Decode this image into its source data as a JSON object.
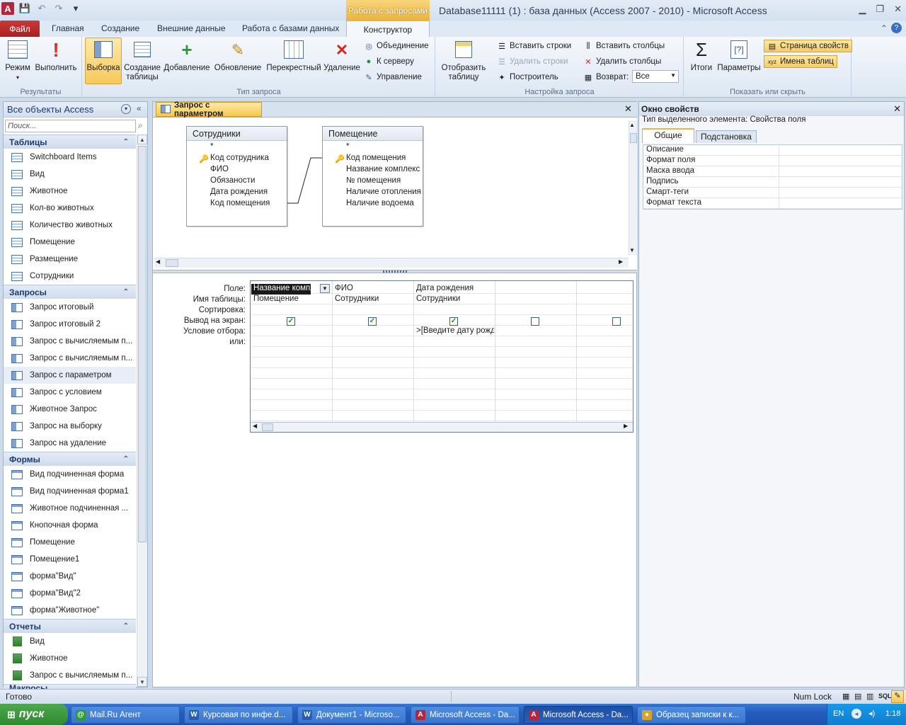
{
  "window": {
    "title": "Database11111 (1) : база данных (Access 2007 - 2010)  -  Microsoft Access",
    "context_tab_title": "Работа с запросами",
    "app_icon_letter": "A"
  },
  "tabs": {
    "file": "Файл",
    "home": "Главная",
    "create": "Создание",
    "external": "Внешние данные",
    "dbtools": "Работа с базами данных",
    "constructor": "Конструктор"
  },
  "ribbon": {
    "results": {
      "label": "Результаты",
      "mode": "Режим",
      "run": "Выполнить"
    },
    "query_type": {
      "label": "Тип запроса",
      "select": "Выборка",
      "make_table": "Создание таблицы",
      "append": "Добавление",
      "update": "Обновление",
      "crosstab": "Перекрестный",
      "delete": "Удаление",
      "union": "Объединение",
      "to_server": "К серверу",
      "management": "Управление"
    },
    "setup": {
      "label": "Настройка запроса",
      "show_table": "Отобразить таблицу",
      "insert_rows": "Вставить строки",
      "delete_rows": "Удалить строки",
      "builder": "Построитель",
      "insert_cols": "Вставить столбцы",
      "delete_cols": "Удалить столбцы",
      "return_label": "Возврат:",
      "return_value": "Все"
    },
    "show_hide": {
      "label": "Показать или скрыть",
      "totals": "Итоги",
      "parameters": "Параметры",
      "property_sheet": "Страница свойств",
      "table_names": "Имена таблиц"
    }
  },
  "nav": {
    "title": "Все объекты Access",
    "search_placeholder": "Поиск...",
    "sections": [
      {
        "title": "Таблицы",
        "type": "table",
        "items": [
          "Switchboard Items",
          "Вид",
          "Животное",
          "Кол-во животных",
          "Количество животных",
          "Помещение",
          "Размещение",
          "Сотрудники"
        ]
      },
      {
        "title": "Запросы",
        "type": "query",
        "items": [
          "Запрос итоговый",
          "Запрос итоговый 2",
          "Запрос с вычисляемым п...",
          "Запрос с вычисляемым п...",
          "Запрос с параметром",
          "Запрос с условием",
          "Животное Запрос",
          "Запрос на выборку",
          "Запрос на удаление"
        ]
      },
      {
        "title": "Формы",
        "type": "form",
        "items": [
          "Вид подчиненная форма",
          "Вид подчиненная форма1",
          "Животное подчиненная ...",
          "Кнопочная форма",
          "Помещение",
          "Помещение1",
          "форма\"Вид\"",
          "форма\"Вид\"2",
          "форма\"Животное\""
        ]
      },
      {
        "title": "Отчеты",
        "type": "report",
        "items": [
          "Вид",
          "Животное",
          "Запрос с вычисляемым п..."
        ]
      }
    ],
    "cut_section": "Макросы",
    "selected_item": "Запрос с параметром"
  },
  "doc": {
    "tab_title": "Запрос с параметром",
    "tables": [
      {
        "name": "Сотрудники",
        "fields": [
          "*",
          "Код сотрудника",
          "ФИО",
          "Обязаности",
          "Дата рождения",
          "Код помещения"
        ],
        "key_field": "Код сотрудника"
      },
      {
        "name": "Помещение",
        "fields": [
          "*",
          "Код помещения",
          "Название комплекс",
          "№ помещения",
          "Наличие отопления",
          "Наличие водоема"
        ],
        "key_field": "Код помещения"
      }
    ],
    "grid": {
      "row_labels": [
        "Поле:",
        "Имя таблицы:",
        "Сортировка:",
        "Вывод на экран:",
        "Условие отбора:",
        "или:"
      ],
      "columns": [
        {
          "field": "Название компле",
          "table": "Помещение",
          "show": true,
          "criteria": ""
        },
        {
          "field": "ФИО",
          "table": "Сотрудники",
          "show": true,
          "criteria": ""
        },
        {
          "field": "Дата рождения",
          "table": "Сотрудники",
          "show": true,
          "criteria": ">[Введите дату рожд"
        },
        {
          "field": "",
          "table": "",
          "show": false,
          "criteria": ""
        },
        {
          "field": "",
          "table": "",
          "show": false,
          "criteria": ""
        }
      ]
    }
  },
  "props": {
    "title": "Окно свойств",
    "selection_type": "Тип выделенного элемента:  Свойства поля",
    "tab_general": "Общие",
    "tab_lookup": "Подстановка",
    "rows": [
      "Описание",
      "Формат поля",
      "Маска ввода",
      "Подпись",
      "Смарт-теги",
      "Формат текста"
    ]
  },
  "status": {
    "ready": "Готово",
    "numlock": "Num Lock",
    "sql": "SQL"
  },
  "taskbar": {
    "start": "пуск",
    "items": [
      "Mail.Ru Агент",
      "Курсовая по инфе.d...",
      "Документ1 - Microso...",
      "Microsoft Access - Da...",
      "Microsoft Access - Da...",
      "Образец записки к к..."
    ],
    "active_index": 4,
    "lang": "EN",
    "time": "1:18"
  }
}
